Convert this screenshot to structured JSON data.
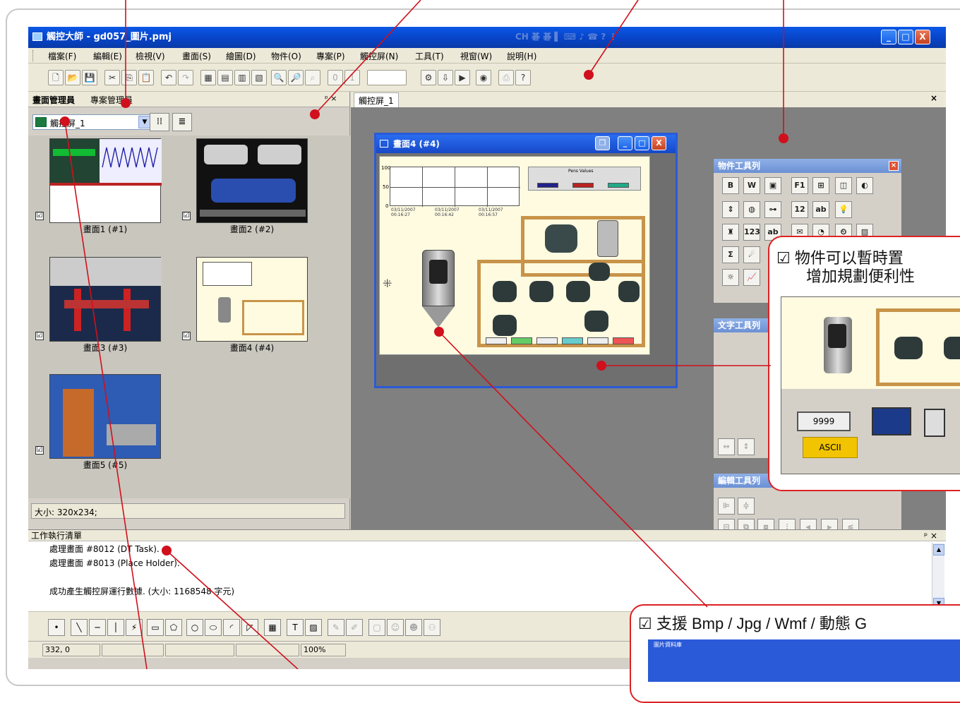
{
  "window": {
    "title": "觸控大師 - gd057_圖片.pmj",
    "ime": "CH 碁 碁 ▌ ⌨ ♪ ☎ ? ⋮",
    "min": "_",
    "max": "□",
    "close": "X"
  },
  "menu": [
    "檔案(F)",
    "編輯(E)",
    "檢視(V)",
    "畫面(S)",
    "繪圖(D)",
    "物件(O)",
    "專案(P)",
    "觸控屏(N)",
    "工具(T)",
    "視窗(W)",
    "說明(H)"
  ],
  "left_panel": {
    "tab_screen": "畫面管理員",
    "tab_project": "專案管理員",
    "pin": "ᵖ ×",
    "combo_value": "觸控屏_1",
    "status": "大小: 320x234;",
    "thumbs": [
      "畫面1 (#1)",
      "畫面2 (#2)",
      "畫面3 (#3)",
      "畫面4 (#4)",
      "畫面5 (#5)"
    ],
    "check": "☑"
  },
  "mdi": {
    "tab": "觸控屏_1",
    "close": "×",
    "child_title": "畫面4 (#4)",
    "chart_y": [
      "100",
      "50",
      "0"
    ],
    "chart_x": [
      "03/11/2007\n00:16:27",
      "03/11/2007\n00:16:42",
      "03/11/2007\n00:16:57"
    ],
    "pens_label": "Pens Values"
  },
  "object_toolbar": {
    "title": "物件工具列",
    "close": "×"
  },
  "text_toolbar": {
    "title": "文字工具列"
  },
  "edit_toolbar": {
    "title": "編輯工具列"
  },
  "output": {
    "title": "工作執行清單",
    "pin": "ᵖ ×",
    "lines": [
      "處理畫面 #8012 (DT Task).",
      "處理畫面 #8013 (Place Holder).",
      "",
      "成功產生觸控屏運行數據. (大小: 1168548 字元)"
    ]
  },
  "statusbar": {
    "coords": "332, 0",
    "zoom": "100%"
  },
  "callout1": {
    "line1": "☑ 物件可以暫時置",
    "line2": "增加規劃便利性",
    "widget_value": "9999",
    "widget_tag": "ASCII"
  },
  "callout2": {
    "line1": "☑ 支援 Bmp / Jpg / Wmf / 動態 G",
    "line2": "圖片資料庫"
  }
}
